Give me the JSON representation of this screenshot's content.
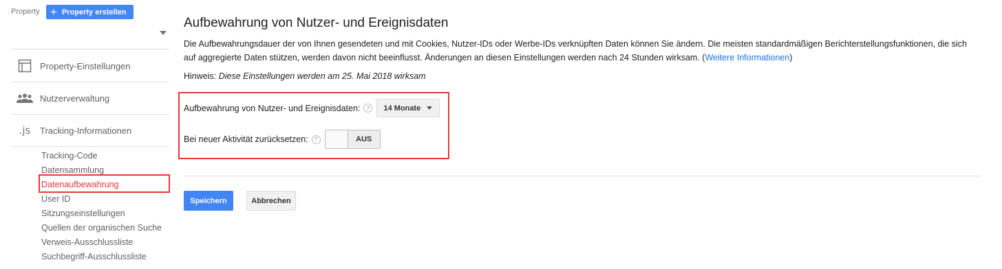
{
  "sidebar": {
    "property_label": "Property",
    "create_button_label": "Property erstellen",
    "property_selected": "",
    "nav_items": [
      {
        "label": "Property-Einstellungen",
        "icon": "layout-icon"
      },
      {
        "label": "Nutzerverwaltung",
        "icon": "users-icon"
      },
      {
        "label": "Tracking-Informationen",
        "icon": "js-icon",
        "glyph": ".js"
      }
    ],
    "sub_items": [
      {
        "label": "Tracking-Code"
      },
      {
        "label": "Datensammlung"
      },
      {
        "label": "Datenaufbewahrung",
        "active": true
      },
      {
        "label": "User ID"
      },
      {
        "label": "Sitzungseinstellungen"
      },
      {
        "label": "Quellen der organischen Suche"
      },
      {
        "label": "Verweis-Ausschlussliste"
      },
      {
        "label": "Suchbegriff-Ausschlussliste"
      }
    ]
  },
  "main": {
    "title": "Aufbewahrung von Nutzer- und Ereignisdaten",
    "description": "Die Aufbewahrungsdauer der von Ihnen gesendeten und mit Cookies, Nutzer-IDs oder Werbe-IDs verknüpften Daten können Sie ändern. Die meisten standardmäßigen Berichterstellungsfunktionen, die sich auf aggregierte Daten stützen, werden davon nicht beeinflusst. Änderungen an diesen Einstellungen werden nach 24 Stunden wirksam. (",
    "description_link": "Weitere Informationen",
    "description_end": ")",
    "hint_label": "Hinweis:",
    "hint_text": "Diese Einstellungen werden am 25. Mai 2018 wirksam",
    "retention_label": "Aufbewahrung von Nutzer- und Ereignisdaten:",
    "retention_value": "14 Monate",
    "reset_label": "Bei neuer Aktivität zurücksetzen:",
    "reset_state": "AUS",
    "help_glyph": "?",
    "save_label": "Speichern",
    "cancel_label": "Abbrechen"
  },
  "colors": {
    "accent": "#4285f4",
    "highlight": "#e53935",
    "link": "#1a73e8"
  }
}
